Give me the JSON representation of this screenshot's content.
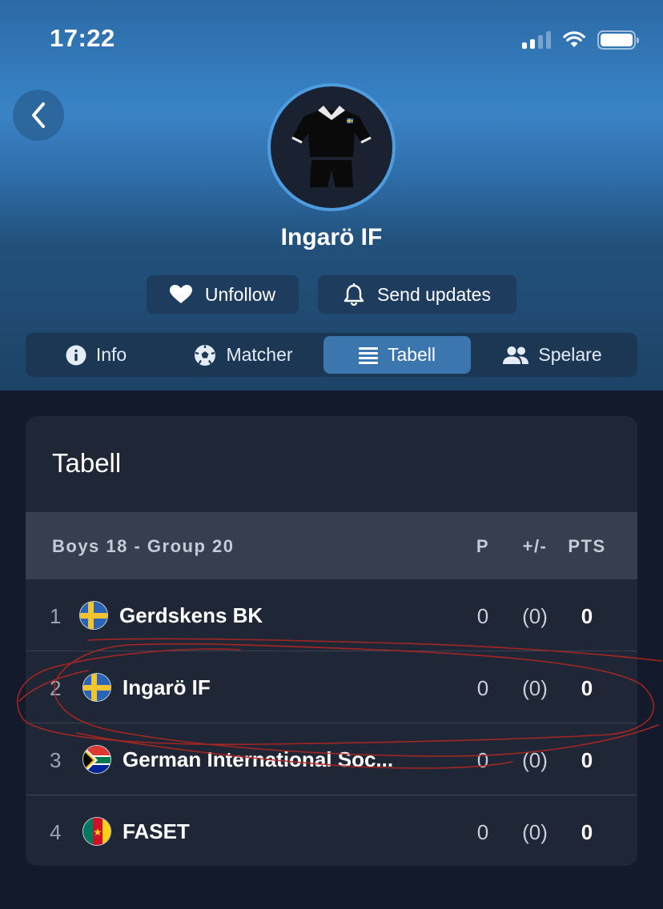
{
  "status_bar": {
    "time": "17:22"
  },
  "team": {
    "name": "Ingarö IF"
  },
  "actions": {
    "unfollow": "Unfollow",
    "send_updates": "Send updates"
  },
  "tabs": [
    {
      "label": "Info",
      "icon": "info-icon"
    },
    {
      "label": "Matcher",
      "icon": "soccer-ball-icon"
    },
    {
      "label": "Tabell",
      "icon": "list-icon",
      "active": true
    },
    {
      "label": "Spelare",
      "icon": "people-icon"
    }
  ],
  "standings": {
    "title": "Tabell",
    "group": "Boys 18 - Group 20",
    "columns": {
      "played": "P",
      "goal_diff": "+/-",
      "points": "PTS"
    },
    "rows": [
      {
        "pos": "1",
        "flag": "sweden-flag-icon",
        "team": "Gerdskens BK",
        "played": "0",
        "diff": "(0)",
        "points": "0"
      },
      {
        "pos": "2",
        "flag": "sweden-flag-icon",
        "team": "Ingarö IF",
        "played": "0",
        "diff": "(0)",
        "points": "0"
      },
      {
        "pos": "3",
        "flag": "south-africa-flag-icon",
        "team": "German International Soc...",
        "played": "0",
        "diff": "(0)",
        "points": "0"
      },
      {
        "pos": "4",
        "flag": "cameroon-flag-icon",
        "team": "FASET",
        "played": "0",
        "diff": "(0)",
        "points": "0"
      }
    ]
  },
  "colors": {
    "accent": "#3b76ae",
    "card_bg": "#1f2737",
    "page_bg": "#121a2b",
    "annotation": "#b3261e"
  }
}
